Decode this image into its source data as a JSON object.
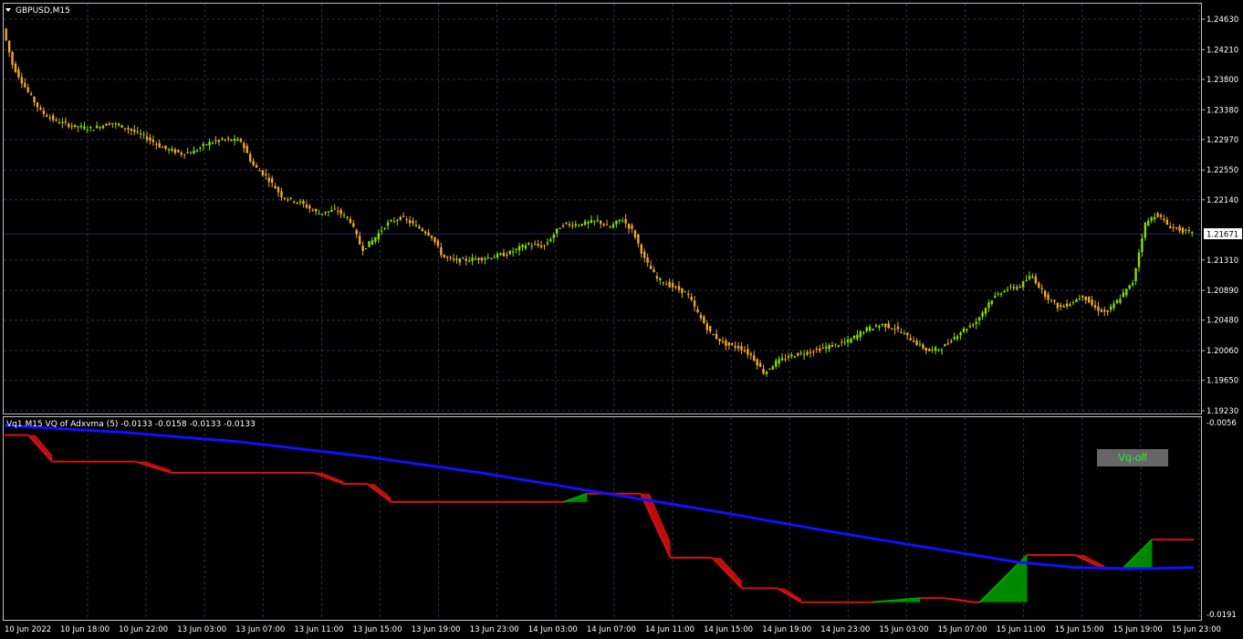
{
  "main_title": "GBPUSD,M15",
  "indicator_title": "Vq1 M15 VQ of Adxvma (5) -0.0133 -0.0158 -0.0133 -0.0133",
  "vq_button_label": "Vq-off",
  "colors": {
    "bull": "#7fe000",
    "bear": "#f5a623",
    "grid": "#303050",
    "vq_down": "#d81010",
    "vq_up": "#00a000",
    "ma": "#1010ff",
    "current_price_line": "#1e2c5a"
  },
  "chart_data": [
    {
      "type": "candlestick",
      "symbol": "GBPUSD",
      "timeframe": "M15",
      "title": "GBPUSD,M15",
      "ylim": [
        1.1923,
        1.2463
      ],
      "yticks": [
        "1.24630",
        "1.24210",
        "1.23800",
        "1.23380",
        "1.22970",
        "1.22550",
        "1.22140",
        "1.21310",
        "1.20890",
        "1.20480",
        "1.20060",
        "1.19650",
        "1.19230"
      ],
      "current_price": "1.21671",
      "grid": true,
      "price_path": [
        {
          "x": 0.0,
          "y": 1.245
        },
        {
          "x": 0.008,
          "y": 1.24
        },
        {
          "x": 0.02,
          "y": 1.2365
        },
        {
          "x": 0.032,
          "y": 1.2335
        },
        {
          "x": 0.045,
          "y": 1.2322
        },
        {
          "x": 0.06,
          "y": 1.2315
        },
        {
          "x": 0.075,
          "y": 1.2312
        },
        {
          "x": 0.09,
          "y": 1.232
        },
        {
          "x": 0.105,
          "y": 1.2312
        },
        {
          "x": 0.12,
          "y": 1.23
        },
        {
          "x": 0.135,
          "y": 1.2285
        },
        {
          "x": 0.15,
          "y": 1.2278
        },
        {
          "x": 0.16,
          "y": 1.228
        },
        {
          "x": 0.172,
          "y": 1.2292
        },
        {
          "x": 0.185,
          "y": 1.2297
        },
        {
          "x": 0.2,
          "y": 1.2295
        },
        {
          "x": 0.21,
          "y": 1.2262
        },
        {
          "x": 0.222,
          "y": 1.2245
        },
        {
          "x": 0.235,
          "y": 1.2218
        },
        {
          "x": 0.25,
          "y": 1.221
        },
        {
          "x": 0.265,
          "y": 1.2195
        },
        {
          "x": 0.28,
          "y": 1.22
        },
        {
          "x": 0.292,
          "y": 1.2185
        },
        {
          "x": 0.302,
          "y": 1.2145
        },
        {
          "x": 0.312,
          "y": 1.216
        },
        {
          "x": 0.322,
          "y": 1.218
        },
        {
          "x": 0.335,
          "y": 1.219
        },
        {
          "x": 0.347,
          "y": 1.2178
        },
        {
          "x": 0.36,
          "y": 1.2165
        },
        {
          "x": 0.37,
          "y": 1.2135
        },
        {
          "x": 0.382,
          "y": 1.213
        },
        {
          "x": 0.395,
          "y": 1.2132
        },
        {
          "x": 0.41,
          "y": 1.2135
        },
        {
          "x": 0.425,
          "y": 1.214
        },
        {
          "x": 0.44,
          "y": 1.2152
        },
        {
          "x": 0.455,
          "y": 1.215
        },
        {
          "x": 0.47,
          "y": 1.218
        },
        {
          "x": 0.485,
          "y": 1.218
        },
        {
          "x": 0.5,
          "y": 1.2185
        },
        {
          "x": 0.51,
          "y": 1.2175
        },
        {
          "x": 0.52,
          "y": 1.2188
        },
        {
          "x": 0.53,
          "y": 1.217
        },
        {
          "x": 0.54,
          "y": 1.213
        },
        {
          "x": 0.55,
          "y": 1.2105
        },
        {
          "x": 0.562,
          "y": 1.2095
        },
        {
          "x": 0.575,
          "y": 1.2085
        },
        {
          "x": 0.585,
          "y": 1.2055
        },
        {
          "x": 0.595,
          "y": 1.203
        },
        {
          "x": 0.607,
          "y": 1.2015
        },
        {
          "x": 0.62,
          "y": 1.201
        },
        {
          "x": 0.63,
          "y": 1.1998
        },
        {
          "x": 0.64,
          "y": 1.1975
        },
        {
          "x": 0.65,
          "y": 1.199
        },
        {
          "x": 0.665,
          "y": 1.2
        },
        {
          "x": 0.68,
          "y": 1.2005
        },
        {
          "x": 0.695,
          "y": 1.2012
        },
        {
          "x": 0.71,
          "y": 1.2018
        },
        {
          "x": 0.725,
          "y": 1.2035
        },
        {
          "x": 0.74,
          "y": 1.2042
        },
        {
          "x": 0.752,
          "y": 1.2035
        },
        {
          "x": 0.765,
          "y": 1.202
        },
        {
          "x": 0.778,
          "y": 1.2005
        },
        {
          "x": 0.79,
          "y": 1.201
        },
        {
          "x": 0.805,
          "y": 1.2032
        },
        {
          "x": 0.818,
          "y": 1.2045
        },
        {
          "x": 0.83,
          "y": 1.2075
        },
        {
          "x": 0.842,
          "y": 1.209
        },
        {
          "x": 0.855,
          "y": 1.2095
        },
        {
          "x": 0.865,
          "y": 1.211
        },
        {
          "x": 0.875,
          "y": 1.2085
        },
        {
          "x": 0.888,
          "y": 1.2065
        },
        {
          "x": 0.898,
          "y": 1.2072
        },
        {
          "x": 0.908,
          "y": 1.2082
        },
        {
          "x": 0.918,
          "y": 1.2065
        },
        {
          "x": 0.928,
          "y": 1.2058
        },
        {
          "x": 0.94,
          "y": 1.208
        },
        {
          "x": 0.95,
          "y": 1.21
        },
        {
          "x": 0.96,
          "y": 1.218
        },
        {
          "x": 0.97,
          "y": 1.2195
        },
        {
          "x": 0.98,
          "y": 1.2178
        },
        {
          "x": 1.0,
          "y": 1.2167
        }
      ]
    },
    {
      "type": "line",
      "title": "Vq1 M15 VQ of Adxvma (5) -0.0133 -0.0158 -0.0133 -0.0133",
      "ylim": [
        -0.0191,
        -0.0056
      ],
      "yticks": [
        "-0.0056",
        "-0.0191"
      ],
      "series": [
        {
          "color": "#1010ff",
          "points": [
            {
              "x": 0.0,
              "y": -0.0056
            },
            {
              "x": 0.1,
              "y": -0.0061
            },
            {
              "x": 0.2,
              "y": -0.0068
            },
            {
              "x": 0.3,
              "y": -0.0078
            },
            {
              "x": 0.4,
              "y": -0.009
            },
            {
              "x": 0.5,
              "y": -0.0104
            },
            {
              "x": 0.6,
              "y": -0.0118
            },
            {
              "x": 0.7,
              "y": -0.0133
            },
            {
              "x": 0.8,
              "y": -0.0147
            },
            {
              "x": 0.85,
              "y": -0.0154
            },
            {
              "x": 0.9,
              "y": -0.0158
            },
            {
              "x": 0.95,
              "y": -0.0159
            },
            {
              "x": 1.0,
              "y": -0.0158
            }
          ]
        },
        {
          "color": "#d81010",
          "points": [
            {
              "x": 0.0,
              "y": -0.0063
            },
            {
              "x": 0.02,
              "y": -0.0063
            },
            {
              "x": 0.04,
              "y": -0.0082
            },
            {
              "x": 0.05,
              "y": -0.0082
            },
            {
              "x": 0.11,
              "y": -0.0082
            },
            {
              "x": 0.14,
              "y": -0.009
            },
            {
              "x": 0.26,
              "y": -0.009
            },
            {
              "x": 0.285,
              "y": -0.0098
            },
            {
              "x": 0.305,
              "y": -0.0098
            },
            {
              "x": 0.325,
              "y": -0.0111
            },
            {
              "x": 0.47,
              "y": -0.0111
            },
            {
              "x": 0.49,
              "y": -0.0105
            },
            {
              "x": 0.535,
              "y": -0.0105
            },
            {
              "x": 0.56,
              "y": -0.0151
            },
            {
              "x": 0.595,
              "y": -0.0151
            },
            {
              "x": 0.62,
              "y": -0.0173
            },
            {
              "x": 0.65,
              "y": -0.0173
            },
            {
              "x": 0.67,
              "y": -0.0183
            },
            {
              "x": 0.73,
              "y": -0.0183
            },
            {
              "x": 0.77,
              "y": -0.018
            },
            {
              "x": 0.79,
              "y": -0.018
            },
            {
              "x": 0.815,
              "y": -0.0183
            },
            {
              "x": 0.82,
              "y": -0.0183
            },
            {
              "x": 0.86,
              "y": -0.0149
            },
            {
              "x": 0.9,
              "y": -0.0149
            },
            {
              "x": 0.925,
              "y": -0.0159
            },
            {
              "x": 0.94,
              "y": -0.0159
            },
            {
              "x": 0.965,
              "y": -0.0138
            },
            {
              "x": 1.0,
              "y": -0.0138
            }
          ]
        }
      ]
    }
  ],
  "x_axis_labels": [
    "10 Jun 2022",
    "10 Jun 18:00",
    "10 Jun 22:00",
    "13 Jun 03:00",
    "13 Jun 07:00",
    "13 Jun 11:00",
    "13 Jun 15:00",
    "13 Jun 19:00",
    "13 Jun 23:00",
    "14 Jun 03:00",
    "14 Jun 07:00",
    "14 Jun 11:00",
    "14 Jun 15:00",
    "14 Jun 19:00",
    "14 Jun 23:00",
    "15 Jun 03:00",
    "15 Jun 07:00",
    "15 Jun 11:00",
    "15 Jun 15:00",
    "15 Jun 19:00",
    "15 Jun 23:00"
  ]
}
